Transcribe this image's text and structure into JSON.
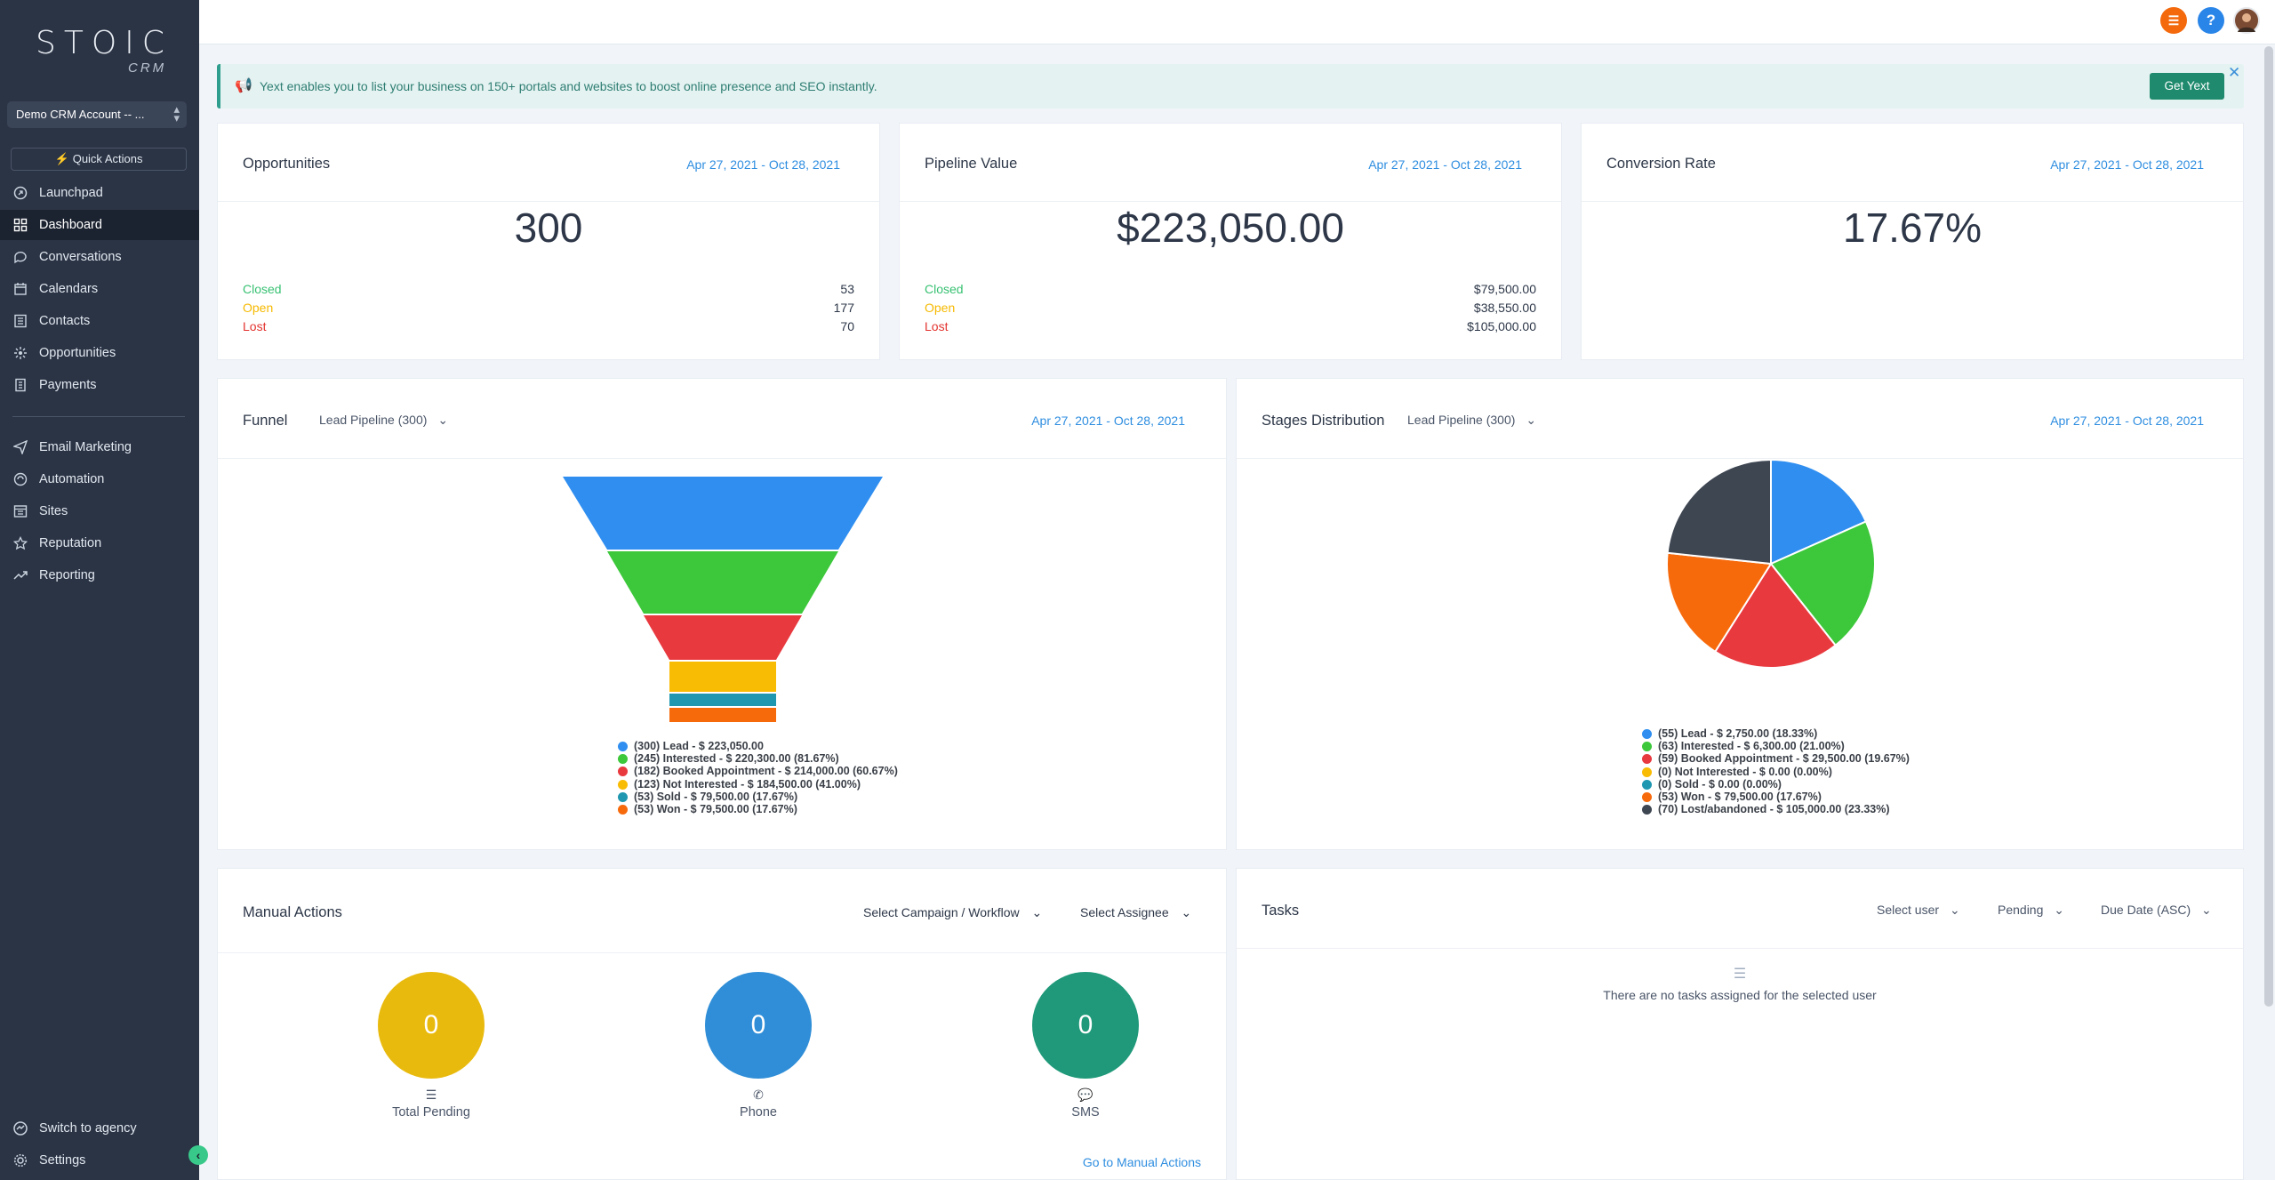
{
  "brand": {
    "name": "STOIC",
    "sub": "CRM"
  },
  "account": {
    "label": "Demo CRM Account -- ..."
  },
  "quick_actions": "Quick Actions",
  "nav": [
    {
      "label": "Launchpad",
      "icon": "rocket-icon"
    },
    {
      "label": "Dashboard",
      "icon": "grid-icon",
      "active": true
    },
    {
      "label": "Conversations",
      "icon": "chat-icon"
    },
    {
      "label": "Calendars",
      "icon": "calendar-icon"
    },
    {
      "label": "Contacts",
      "icon": "contacts-icon"
    },
    {
      "label": "Opportunities",
      "icon": "filter-icon"
    },
    {
      "label": "Payments",
      "icon": "invoice-icon"
    },
    {
      "label": "Email Marketing",
      "icon": "send-icon"
    },
    {
      "label": "Automation",
      "icon": "gear-icon"
    },
    {
      "label": "Sites",
      "icon": "sites-icon"
    },
    {
      "label": "Reputation",
      "icon": "star-icon"
    },
    {
      "label": "Reporting",
      "icon": "trend-icon"
    }
  ],
  "bottom_nav": {
    "switch": "Switch to agency",
    "settings": "Settings"
  },
  "banner": {
    "text": "Yext enables you to list your business on 150+ portals and websites to boost online presence and SEO instantly.",
    "button": "Get Yext"
  },
  "cards": {
    "opportunities": {
      "title": "Opportunities",
      "date": "Apr 27, 2021 - Oct 28, 2021",
      "value": "300",
      "stats": [
        {
          "label": "Closed",
          "value": "53",
          "color": "#38c172"
        },
        {
          "label": "Open",
          "value": "177",
          "color": "#f6b900"
        },
        {
          "label": "Lost",
          "value": "70",
          "color": "#e3342f"
        }
      ]
    },
    "pipeline": {
      "title": "Pipeline Value",
      "date": "Apr 27, 2021 - Oct 28, 2021",
      "value": "$223,050.00",
      "stats": [
        {
          "label": "Closed",
          "value": "$79,500.00",
          "color": "#38c172"
        },
        {
          "label": "Open",
          "value": "$38,550.00",
          "color": "#f6b900"
        },
        {
          "label": "Lost",
          "value": "$105,000.00",
          "color": "#e3342f"
        }
      ]
    },
    "conversion": {
      "title": "Conversion Rate",
      "date": "Apr 27, 2021 - Oct 28, 2021",
      "value": "17.67%"
    }
  },
  "funnel": {
    "title": "Funnel",
    "pipeline": "Lead Pipeline (300)",
    "date": "Apr 27, 2021 - Oct 28, 2021"
  },
  "stages": {
    "title": "Stages Distribution",
    "pipeline": "Lead Pipeline (300)",
    "date": "Apr 27, 2021 - Oct 28, 2021"
  },
  "chart_data": [
    {
      "type": "funnel",
      "stages": [
        {
          "label": "(300) Lead - $ 223,050.00",
          "count": 300,
          "color": "#2f8ef0"
        },
        {
          "label": "(245) Interested - $ 220,300.00 (81.67%)",
          "count": 245,
          "color": "#3cc83a"
        },
        {
          "label": "(182) Booked Appointment - $ 214,000.00 (60.67%)",
          "count": 182,
          "color": "#e8393f"
        },
        {
          "label": "(123) Not Interested - $ 184,500.00 (41.00%)",
          "count": 123,
          "color": "#f9bc05"
        },
        {
          "label": "(53) Sold - $ 79,500.00 (17.67%)",
          "count": 53,
          "color": "#1f97b0"
        },
        {
          "label": "(53) Won - $ 79,500.00 (17.67%)",
          "count": 53,
          "color": "#f76a0c"
        }
      ]
    },
    {
      "type": "pie",
      "slices": [
        {
          "label": "(55) Lead - $ 2,750.00 (18.33%)",
          "value": 55,
          "color": "#2f8ef0"
        },
        {
          "label": "(63) Interested - $ 6,300.00 (21.00%)",
          "value": 63,
          "color": "#3cc83a"
        },
        {
          "label": "(59) Booked Appointment - $ 29,500.00 (19.67%)",
          "value": 59,
          "color": "#e8393f"
        },
        {
          "label": "(0) Not Interested - $ 0.00 (0.00%)",
          "value": 0,
          "color": "#f9bc05"
        },
        {
          "label": "(0) Sold - $ 0.00 (0.00%)",
          "value": 0,
          "color": "#1f97b0"
        },
        {
          "label": "(53) Won - $ 79,500.00 (17.67%)",
          "value": 53,
          "color": "#f76a0c"
        },
        {
          "label": "(70) Lost/abandoned - $ 105,000.00 (23.33%)",
          "value": 70,
          "color": "#3e4652"
        }
      ]
    }
  ],
  "manual": {
    "title": "Manual Actions",
    "campaign": "Select Campaign / Workflow",
    "assignee": "Select Assignee",
    "link": "Go to Manual Actions",
    "circles": [
      {
        "value": "0",
        "label": "Total Pending",
        "color": "#e9ba0e",
        "icon": "list-icon"
      },
      {
        "value": "0",
        "label": "Phone",
        "color": "#2f8ed7",
        "icon": "phone-icon"
      },
      {
        "value": "0",
        "label": "SMS",
        "color": "#1f9979",
        "icon": "sms-icon"
      }
    ]
  },
  "tasks": {
    "title": "Tasks",
    "user": "Select user",
    "status": "Pending",
    "sort": "Due Date (ASC)",
    "empty": "There are no tasks assigned for the selected user"
  }
}
